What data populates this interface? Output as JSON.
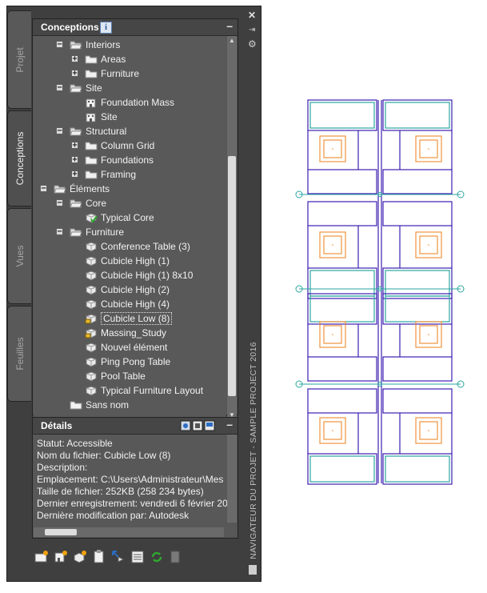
{
  "palette": {
    "side_tabs": [
      "Projet",
      "Conceptions",
      "Vues",
      "Feuilles"
    ],
    "active_tab": "Conceptions",
    "vertical_title": "NAVIGATEUR DU PROJET - SAMPLE PROJECT 2016",
    "window_buttons": [
      "close-icon",
      "pin-icon",
      "properties-icon"
    ]
  },
  "conceptions": {
    "title": "Conceptions",
    "info_glyph": "i",
    "collapse": "–",
    "tree": [
      {
        "label": "Interiors",
        "level": 1,
        "icon": "folder-open",
        "expander": "−"
      },
      {
        "label": "Areas",
        "level": 2,
        "icon": "folder",
        "expander": "+"
      },
      {
        "label": "Furniture",
        "level": 2,
        "icon": "folder",
        "expander": "+"
      },
      {
        "label": "Site",
        "level": 1,
        "icon": "folder-open",
        "expander": "−"
      },
      {
        "label": "Foundation Mass",
        "level": 2,
        "icon": "building",
        "expander": ""
      },
      {
        "label": "Site",
        "level": 2,
        "icon": "building",
        "expander": ""
      },
      {
        "label": "Structural",
        "level": 1,
        "icon": "folder-open",
        "expander": "−"
      },
      {
        "label": "Column Grid",
        "level": 2,
        "icon": "folder",
        "expander": "+"
      },
      {
        "label": "Foundations",
        "level": 2,
        "icon": "folder",
        "expander": "+"
      },
      {
        "label": "Framing",
        "level": 2,
        "icon": "folder",
        "expander": "+"
      },
      {
        "label": "Éléments",
        "level": 0,
        "icon": "folder-open",
        "expander": "−"
      },
      {
        "label": "Core",
        "level": 1,
        "icon": "folder-open",
        "expander": "−"
      },
      {
        "label": "Typical Core",
        "level": 2,
        "icon": "element-check",
        "expander": ""
      },
      {
        "label": "Furniture",
        "level": 1,
        "icon": "folder-open",
        "expander": "−"
      },
      {
        "label": "Conference Table (3)",
        "level": 2,
        "icon": "element",
        "expander": ""
      },
      {
        "label": "Cubicle High (1)",
        "level": 2,
        "icon": "element",
        "expander": ""
      },
      {
        "label": "Cubicle High (1) 8x10",
        "level": 2,
        "icon": "element",
        "expander": ""
      },
      {
        "label": "Cubicle High (2)",
        "level": 2,
        "icon": "element",
        "expander": ""
      },
      {
        "label": "Cubicle High (4)",
        "level": 2,
        "icon": "element",
        "expander": ""
      },
      {
        "label": "Cubicle Low (8)",
        "level": 2,
        "icon": "element-lock",
        "expander": "",
        "selected": true
      },
      {
        "label": "Massing_Study",
        "level": 2,
        "icon": "element-lock",
        "expander": ""
      },
      {
        "label": "Nouvel élément",
        "level": 2,
        "icon": "element",
        "expander": ""
      },
      {
        "label": "Ping Pong Table",
        "level": 2,
        "icon": "element",
        "expander": ""
      },
      {
        "label": "Pool Table",
        "level": 2,
        "icon": "element",
        "expander": ""
      },
      {
        "label": "Typical Furniture Layout",
        "level": 2,
        "icon": "element",
        "expander": ""
      },
      {
        "label": "Sans nom",
        "level": 1,
        "icon": "folder",
        "expander": ""
      }
    ]
  },
  "details": {
    "title": "Détails",
    "collapse": "–",
    "lines": [
      "Statut: Accessible",
      "Nom du fichier: Cubicle Low (8)",
      "Description:",
      "Emplacement: C:\\Users\\Administrateur\\Mes",
      "Taille de fichier: 252KB (258 234 bytes)",
      "Dernier enregistrement: vendredi 6 février 20",
      "Dernière modification par: Autodesk"
    ]
  },
  "toolbar": [
    "new-folder-icon",
    "add-building-icon",
    "new-element-icon",
    "paste-icon",
    "attach-xref-icon",
    "properties-icon",
    "refresh-icon",
    "repath-icon"
  ],
  "colors": {
    "wall": "#3c1fb0",
    "cyan": "#2aa6a0",
    "furniture": "#ee8a2c",
    "panel": "#3f3f3f"
  }
}
